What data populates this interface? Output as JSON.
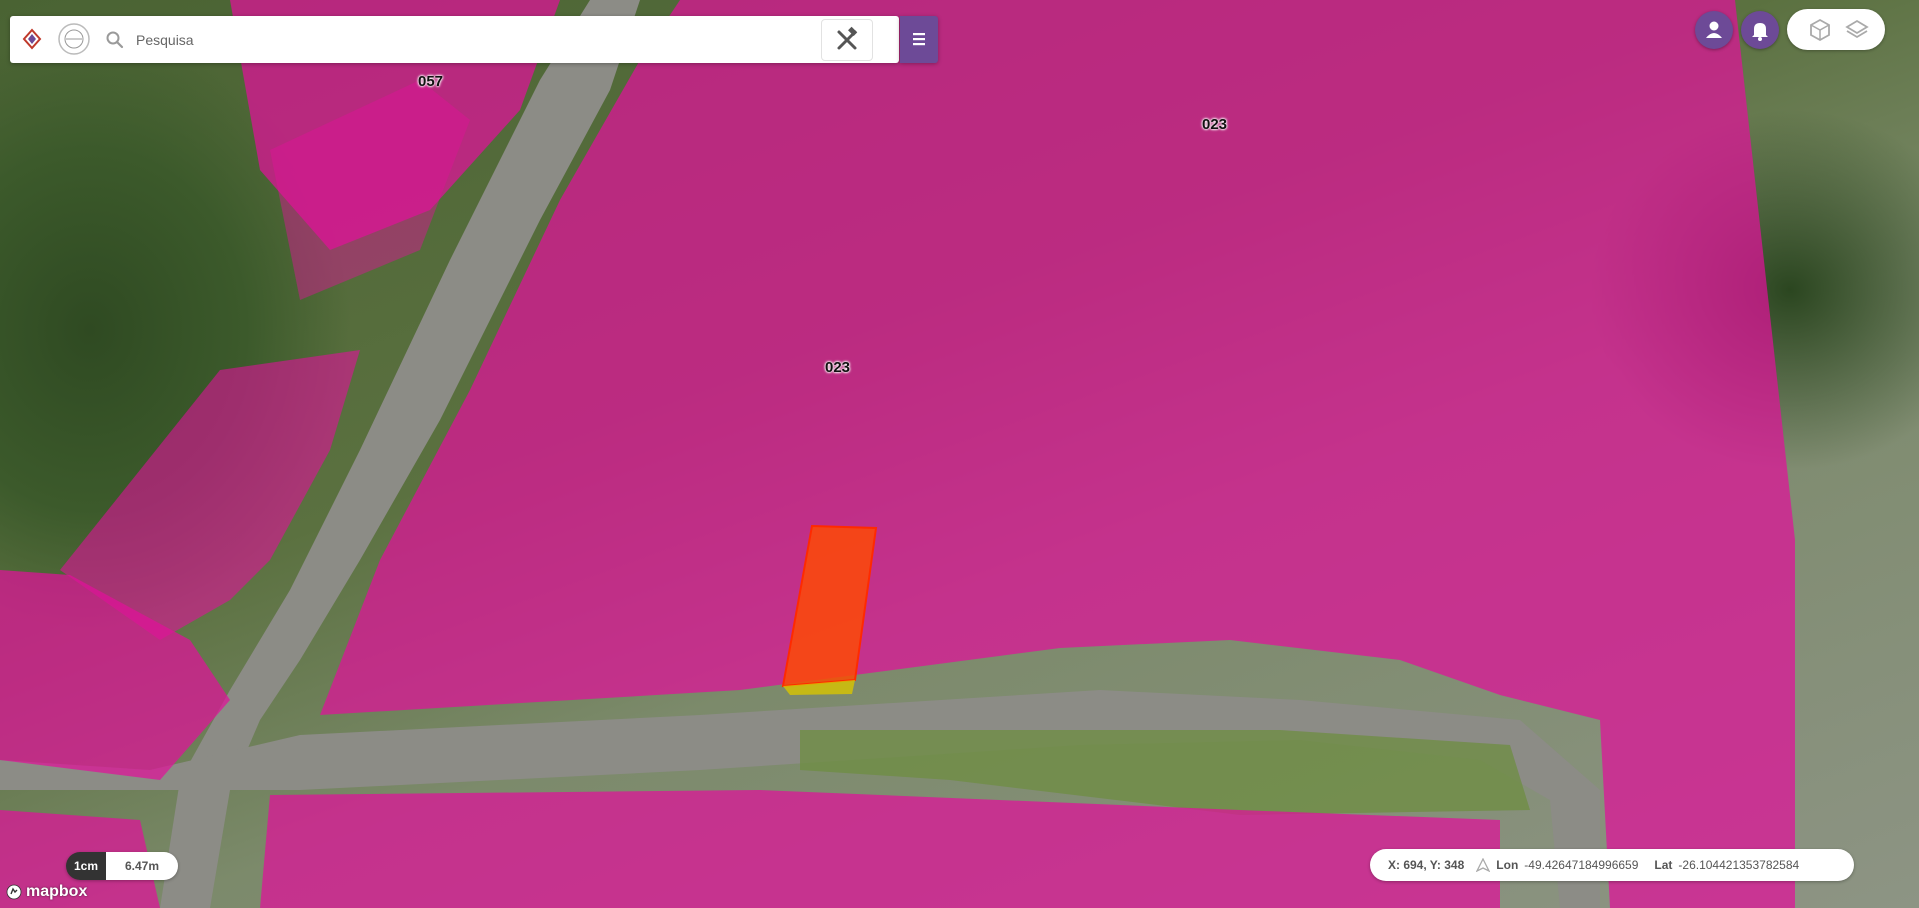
{
  "search": {
    "placeholder": "Pesquisa"
  },
  "icons": {
    "logo": "logo-icon",
    "search": "search-icon",
    "tools": "tools-icon",
    "menu": "hamburger-menu-icon",
    "user": "user-icon",
    "notifications": "bell-icon",
    "layers_3d": "cube-icon",
    "layers": "layers-icon",
    "north": "north-arrow-icon"
  },
  "colors": {
    "accent": "#6d4a97",
    "parcel_fill": "#e0119a",
    "selected_parcel": "#ff4a00"
  },
  "parcels": {
    "labels": [
      "057",
      "023",
      "023"
    ]
  },
  "scale": {
    "unit": "1cm",
    "value": "6.47m"
  },
  "attribution": {
    "mapbox": "mapbox"
  },
  "coordinates": {
    "xy_label": "X: 694, Y: 348",
    "lon_label": "Lon",
    "lon_value": "-49.42647184996659",
    "lat_label": "Lat",
    "lat_value": "-26.104421353782584"
  }
}
